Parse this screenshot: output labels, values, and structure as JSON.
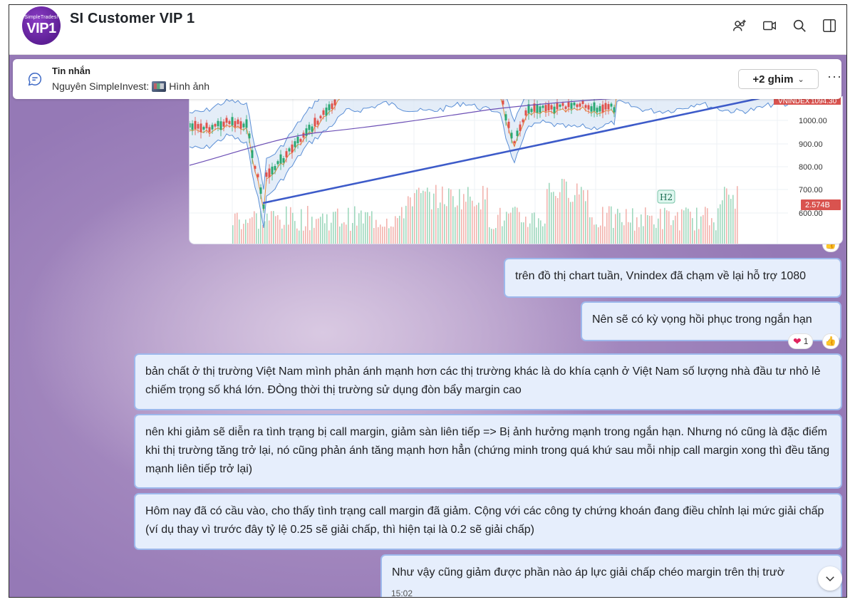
{
  "header": {
    "avatar_small": "SimpleTrades!",
    "avatar_big": "VIP1",
    "title": "SI  Customer VIP 1",
    "icons": [
      "add-member-icon",
      "video-call-icon",
      "search-icon",
      "side-panel-icon"
    ]
  },
  "pinned": {
    "label": "Tin nhắn",
    "sender": "Nguyên SimpleInvest:",
    "attachment": "Hình ảnh",
    "pins_button": "+2 ghim",
    "more": "···"
  },
  "chart_image": {
    "price_tag": "VNINDEX",
    "price_value": "1094.30",
    "volume_value": "2.574B",
    "annotation": "H2",
    "y_ticks": [
      "1000.00",
      "900.00",
      "800.00",
      "700.00",
      "600.00"
    ]
  },
  "chart_data": {
    "type": "line",
    "title": "",
    "xlabel": "",
    "ylabel": "",
    "ylim": [
      600,
      1100
    ],
    "y_ticks": [
      1000,
      900,
      800,
      700,
      600
    ],
    "series": [
      {
        "name": "VNINDEX",
        "values": [
          1094.3
        ]
      }
    ],
    "annotations": [
      "H2",
      "2.574B"
    ]
  },
  "messages": [
    {
      "text": "trên đồ thị chart tuần, Vnindex  đã chạm về lại hỗ trợ 1080"
    },
    {
      "text": "Nên sẽ có kỳ vọng hồi phục trong ngắn hạn",
      "reaction_count": "1"
    },
    {
      "text": "bản chất ở thị trường Việt Nam mình phản ánh mạnh hơn các thị trường khác là do khía cạnh ở Việt Nam số lượng nhà đầu tư nhỏ lẻ chiếm trọng số khá lớn. ĐÒng thời thị trường sử dụng đòn bẩy margin cao"
    },
    {
      "text": "nên khi giảm sẽ diễn ra tình trạng bị call margin, giảm sàn liên tiếp => Bị ảnh hưởng mạnh trong ngắn hạn. Nhưng nó cũng là đặc điểm khi thị trường tăng trở lại, nó cũng phản ánh tăng mạnh hơn hẳn (chứng minh trong quá khứ sau mỗi nhịp call margin xong thì đều tăng mạnh liên tiếp trở lại)"
    },
    {
      "text": "Hôm nay đã có cầu vào, cho thấy tình trạng call margin đã giảm. Cộng với các công ty chứng khoán đang điều chỉnh lại mức giải chấp (ví dụ thay vì trước đây tỷ lệ 0.25 sẽ giải chấp, thì hiện tại là 0.2 sẽ giải chấp)"
    },
    {
      "text": "Như vậy cũng giảm được phần nào áp lực giải chấp chéo margin trên thị trườ",
      "time": "15:02"
    }
  ],
  "colors": {
    "chat_bg": "#9579b6",
    "bubble_bg": "#e6eefc",
    "bubble_border": "#9db8ec",
    "trendline": "#3d5bc9",
    "price_tag": "#d9534f"
  }
}
